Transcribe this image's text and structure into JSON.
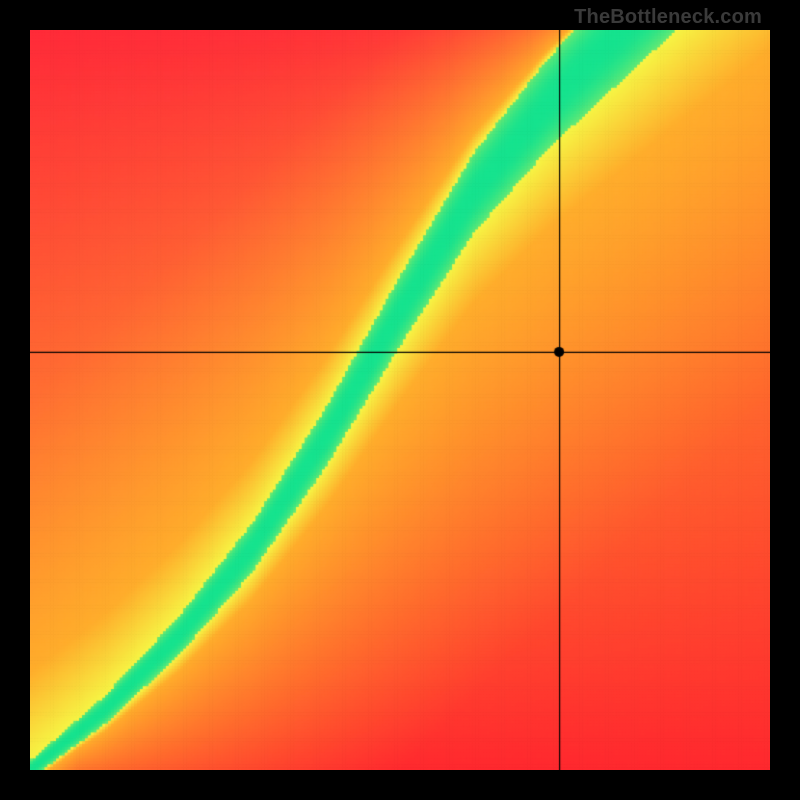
{
  "watermark": "TheBottleneck.com",
  "chart_data": {
    "type": "heatmap",
    "title": "",
    "xlabel": "",
    "ylabel": "",
    "xlim": [
      0,
      1
    ],
    "ylim": [
      0,
      1
    ],
    "marker": {
      "x": 0.715,
      "y": 0.565
    },
    "crosshair": {
      "x": 0.715,
      "y": 0.565
    },
    "ridge_points": [
      {
        "x": 0.0,
        "y": 0.0
      },
      {
        "x": 0.1,
        "y": 0.08
      },
      {
        "x": 0.2,
        "y": 0.18
      },
      {
        "x": 0.3,
        "y": 0.3
      },
      {
        "x": 0.4,
        "y": 0.45
      },
      {
        "x": 0.5,
        "y": 0.62
      },
      {
        "x": 0.6,
        "y": 0.78
      },
      {
        "x": 0.7,
        "y": 0.9
      },
      {
        "x": 0.8,
        "y": 1.0
      },
      {
        "x": 0.9,
        "y": 1.1
      },
      {
        "x": 1.0,
        "y": 1.2
      }
    ],
    "colors": {
      "ridge": "#16e38f",
      "near": "#f7f545",
      "mid_warm": "#ffae2c",
      "far_tl": "#ff2a3a",
      "far_br": "#ff2030"
    },
    "grid_resolution": 256
  }
}
